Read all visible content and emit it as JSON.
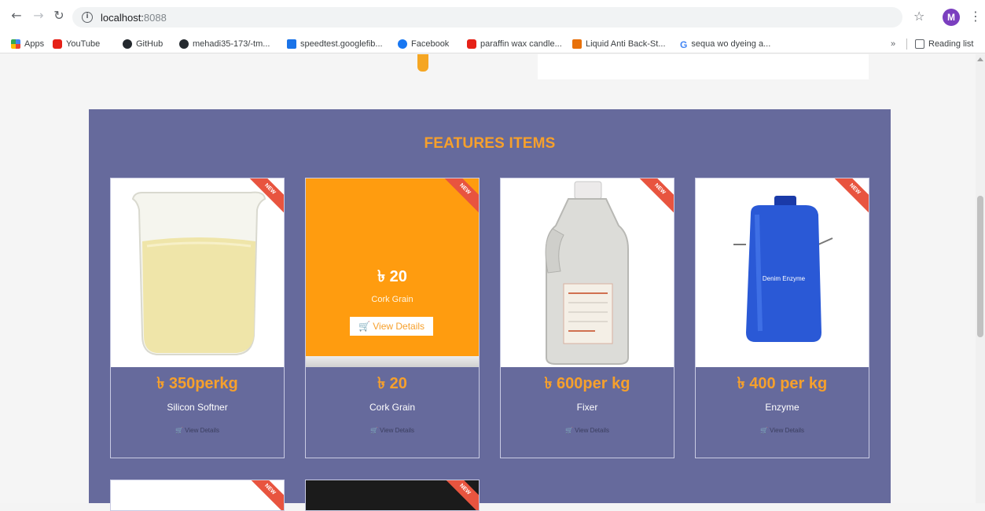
{
  "browser": {
    "url_host": "localhost:",
    "url_port": "8088",
    "avatar_letter": "M",
    "nav_icons": [
      "back-arrow-icon",
      "forward-arrow-icon",
      "reload-icon"
    ],
    "bookmarks": [
      {
        "label": "Apps",
        "icon": "apps-grid-icon"
      },
      {
        "label": "YouTube",
        "icon": "youtube-icon"
      },
      {
        "label": "GitHub",
        "icon": "github-icon"
      },
      {
        "label": "mehadi35-173/-tm...",
        "icon": "github-icon"
      },
      {
        "label": "speedtest.googlefib...",
        "icon": "speedtest-icon"
      },
      {
        "label": "Facebook",
        "icon": "facebook-icon"
      },
      {
        "label": "paraffin wax candle...",
        "icon": "youtube-icon"
      },
      {
        "label": "Liquid Anti Back-St...",
        "icon": "orange-site-icon"
      },
      {
        "label": "sequa wo dyeing a...",
        "icon": "google-icon"
      }
    ],
    "more_bookmarks": "»",
    "reading_list": "Reading list"
  },
  "features": {
    "title": "FEATURES ITEMS",
    "badge": "NEW",
    "products": [
      {
        "price": "৳ 350perkg",
        "name": "Silicon Softner",
        "view_label": "View Details"
      },
      {
        "price": "৳ 20",
        "name": "Cork Grain",
        "view_label": "View Details"
      },
      {
        "price": "৳ 600per kg",
        "name": "Fixer",
        "view_label": "View Details"
      },
      {
        "price": "৳ 400 per kg",
        "name": "Enzyme",
        "view_label": "View Details"
      }
    ],
    "hover_card": {
      "price": "৳ 20",
      "name": "Cork Grain",
      "button": "View Details"
    },
    "enzyme_label": "Denim Enzyme"
  },
  "colors": {
    "section_bg": "#666a9c",
    "accent": "#f6a02c",
    "hover_overlay": "#ff9c0f",
    "badge": "#e8543f"
  }
}
